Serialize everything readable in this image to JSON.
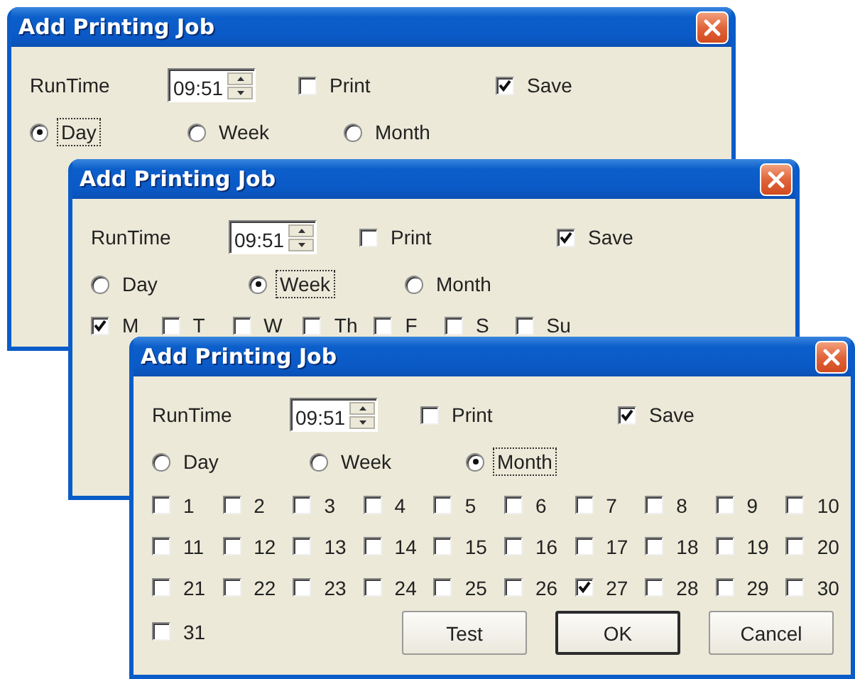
{
  "windows": [
    {
      "title": "Add Printing Job",
      "runtime": {
        "label": "RunTime",
        "value": "09:51"
      },
      "print": {
        "label": "Print",
        "checked": false
      },
      "save": {
        "label": "Save",
        "checked": true
      },
      "schedule": [
        {
          "label": "Day",
          "selected": true
        },
        {
          "label": "Week",
          "selected": false
        },
        {
          "label": "Month",
          "selected": false
        }
      ]
    },
    {
      "title": "Add Printing Job",
      "runtime": {
        "label": "RunTime",
        "value": "09:51"
      },
      "print": {
        "label": "Print",
        "checked": false
      },
      "save": {
        "label": "Save",
        "checked": true
      },
      "schedule": [
        {
          "label": "Day",
          "selected": false
        },
        {
          "label": "Week",
          "selected": true
        },
        {
          "label": "Month",
          "selected": false
        }
      ],
      "weekdays": [
        {
          "label": "M",
          "checked": true
        },
        {
          "label": "T",
          "checked": false
        },
        {
          "label": "W",
          "checked": false
        },
        {
          "label": "Th",
          "checked": false
        },
        {
          "label": "F",
          "checked": false
        },
        {
          "label": "S",
          "checked": false
        },
        {
          "label": "Su",
          "checked": false
        }
      ]
    },
    {
      "title": "Add Printing Job",
      "runtime": {
        "label": "RunTime",
        "value": "09:51"
      },
      "print": {
        "label": "Print",
        "checked": false
      },
      "save": {
        "label": "Save",
        "checked": true
      },
      "schedule": [
        {
          "label": "Day",
          "selected": false
        },
        {
          "label": "Week",
          "selected": false
        },
        {
          "label": "Month",
          "selected": true
        }
      ],
      "days": [
        {
          "label": "1",
          "checked": false
        },
        {
          "label": "2",
          "checked": false
        },
        {
          "label": "3",
          "checked": false
        },
        {
          "label": "4",
          "checked": false
        },
        {
          "label": "5",
          "checked": false
        },
        {
          "label": "6",
          "checked": false
        },
        {
          "label": "7",
          "checked": false
        },
        {
          "label": "8",
          "checked": false
        },
        {
          "label": "9",
          "checked": false
        },
        {
          "label": "10",
          "checked": false
        },
        {
          "label": "11",
          "checked": false
        },
        {
          "label": "12",
          "checked": false
        },
        {
          "label": "13",
          "checked": false
        },
        {
          "label": "14",
          "checked": false
        },
        {
          "label": "15",
          "checked": false
        },
        {
          "label": "16",
          "checked": false
        },
        {
          "label": "17",
          "checked": false
        },
        {
          "label": "18",
          "checked": false
        },
        {
          "label": "19",
          "checked": false
        },
        {
          "label": "20",
          "checked": false
        },
        {
          "label": "21",
          "checked": false
        },
        {
          "label": "22",
          "checked": false
        },
        {
          "label": "23",
          "checked": false
        },
        {
          "label": "24",
          "checked": false
        },
        {
          "label": "25",
          "checked": false
        },
        {
          "label": "26",
          "checked": false
        },
        {
          "label": "27",
          "checked": true
        },
        {
          "label": "28",
          "checked": false
        },
        {
          "label": "29",
          "checked": false
        },
        {
          "label": "30",
          "checked": false
        },
        {
          "label": "31",
          "checked": false
        }
      ],
      "buttons": [
        {
          "label": "Test",
          "default": false
        },
        {
          "label": "OK",
          "default": true
        },
        {
          "label": "Cancel",
          "default": false
        }
      ]
    }
  ]
}
